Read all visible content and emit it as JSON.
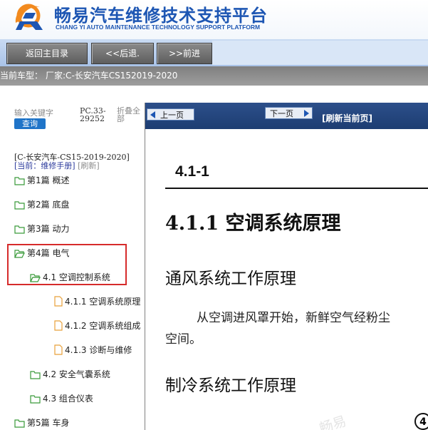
{
  "header": {
    "title": "畅易汽车维修技术支持平台",
    "subtitle": "CHANG YI AUTO MAINTENANCE TECHNOLOGY SUPPORT PLATFORM",
    "colors": {
      "title": "#1d56b3",
      "logo_orange": "#f28a1e",
      "logo_blue": "#1d56b3"
    }
  },
  "toolbar": {
    "home_label": "返回主目录",
    "back_label": "<<后退.",
    "forward_label": ">>前进"
  },
  "vehicle": {
    "prefix": "当前车型：",
    "text": "厂家:C-长安汽车CS152019-2020"
  },
  "sidebar": {
    "keyword_label": "输入关键字",
    "search_label": "查询",
    "code": "PC.33-29252",
    "collapse_label": "折叠全部",
    "model": "[C-长安汽车-CS15-2019-2020]",
    "current": "[当前：维修手册]",
    "refresh": "[刷新]",
    "tree": [
      {
        "label": "第1篇 概述",
        "type": "folder",
        "open": false
      },
      {
        "label": "第2篇 底盘",
        "type": "folder",
        "open": false
      },
      {
        "label": "第3篇 动力",
        "type": "folder",
        "open": false
      },
      {
        "label": "第4篇 电气",
        "type": "folder",
        "open": true,
        "highlighted": true
      },
      {
        "label": "4.1 空调控制系统",
        "type": "folder",
        "open": true,
        "highlighted": true
      },
      {
        "label": "4.1.1 空调系统原理",
        "type": "page"
      },
      {
        "label": "4.1.2 空调系统组成",
        "type": "page"
      },
      {
        "label": "4.1.3 诊断与维修",
        "type": "page"
      },
      {
        "label": "4.2 安全气囊系统",
        "type": "folder",
        "open": false
      },
      {
        "label": "4.3 组合仪表",
        "type": "folder",
        "open": false
      },
      {
        "label": "第5篇 车身",
        "type": "folder",
        "open": false
      }
    ]
  },
  "pager": {
    "prev_label": "上一页",
    "next_label": "下一页",
    "refresh_label": "[刷新当前页]"
  },
  "content": {
    "section_number": "4.1-1",
    "h1": "4.1.1 空调系统原理",
    "h2_ventilation": "通风系统工作原理",
    "para_line1": "从空调进风罩开始，新鲜空气经粉尘",
    "para_line2": "空间。",
    "h2_cooling": "制冷系统工作原理",
    "watermark": "畅易",
    "page_mark": "4"
  }
}
